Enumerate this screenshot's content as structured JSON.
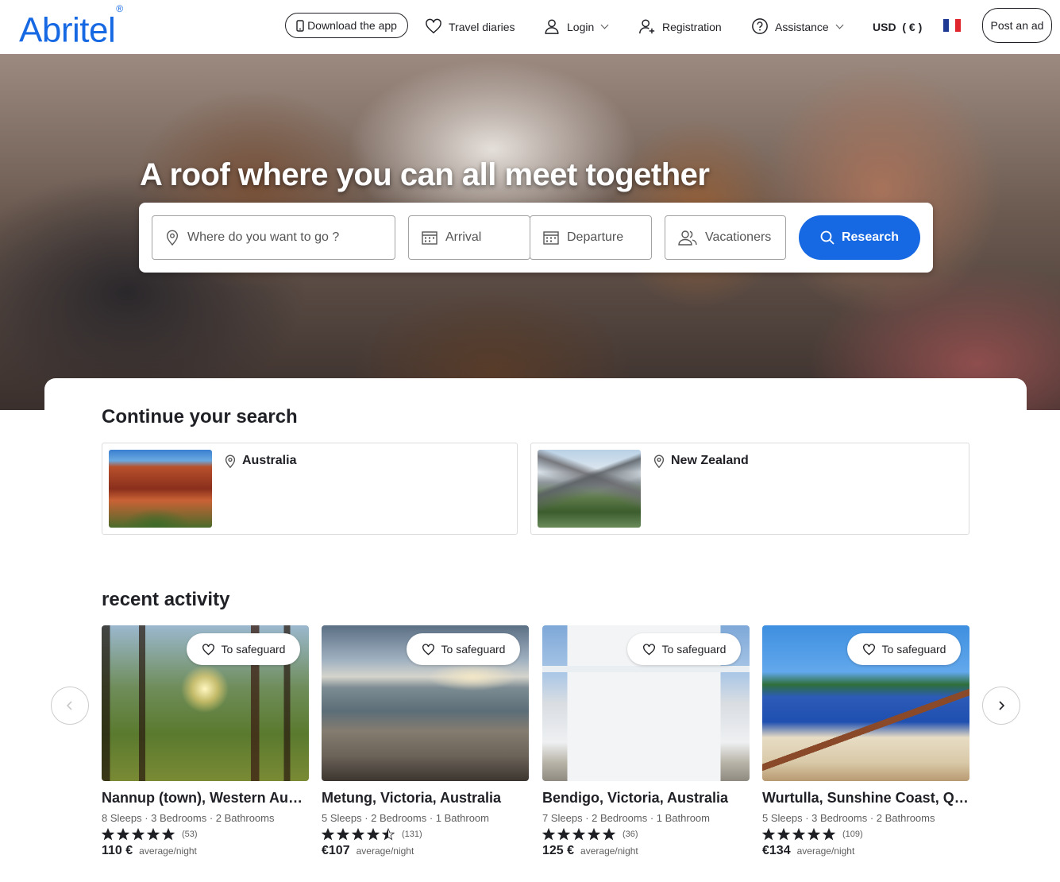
{
  "header": {
    "logo": "Abritel",
    "download_app": "Download the app",
    "travel_diaries": "Travel diaries",
    "login": "Login",
    "registration": "Registration",
    "assistance": "Assistance",
    "currency": "USD  ( € )",
    "post_ad": "Post an ad"
  },
  "hero": {
    "title": "A roof where you can all meet together"
  },
  "search": {
    "destination_placeholder": "Where do you want to go ?",
    "arrival": "Arrival",
    "departure": "Departure",
    "vacationers": "Vacationers",
    "research_button": "Research"
  },
  "continue_search": {
    "heading": "Continue your search",
    "items": [
      {
        "label": "Australia"
      },
      {
        "label": "New Zealand"
      }
    ]
  },
  "recent_activity": {
    "heading": "recent activity",
    "save_label": "To safeguard",
    "unit_label": "average/night",
    "items": [
      {
        "title": "Nannup (town), Western Australia, Australia",
        "meta": "8 Sleeps · 3 Bedrooms · 2 Bathrooms",
        "rating": 5,
        "reviews": "(53)",
        "price": "110 €"
      },
      {
        "title": "Metung, Victoria, Australia",
        "meta": "5 Sleeps · 2 Bedrooms · 1 Bathroom",
        "rating": 4.5,
        "reviews": "(131)",
        "price": "€107"
      },
      {
        "title": "Bendigo, Victoria, Australia",
        "meta": "7 Sleeps · 2 Bedrooms · 1 Bathroom",
        "rating": 5,
        "reviews": "(36)",
        "price": "125 €"
      },
      {
        "title": "Wurtulla, Sunshine Coast, Queensland, Australia",
        "meta": "5 Sleeps · 3 Bedrooms · 2 Bathrooms",
        "rating": 5,
        "reviews": "(109)",
        "price": "€134"
      }
    ]
  },
  "colors": {
    "brand": "#1668e3",
    "text": "#1f2025"
  }
}
